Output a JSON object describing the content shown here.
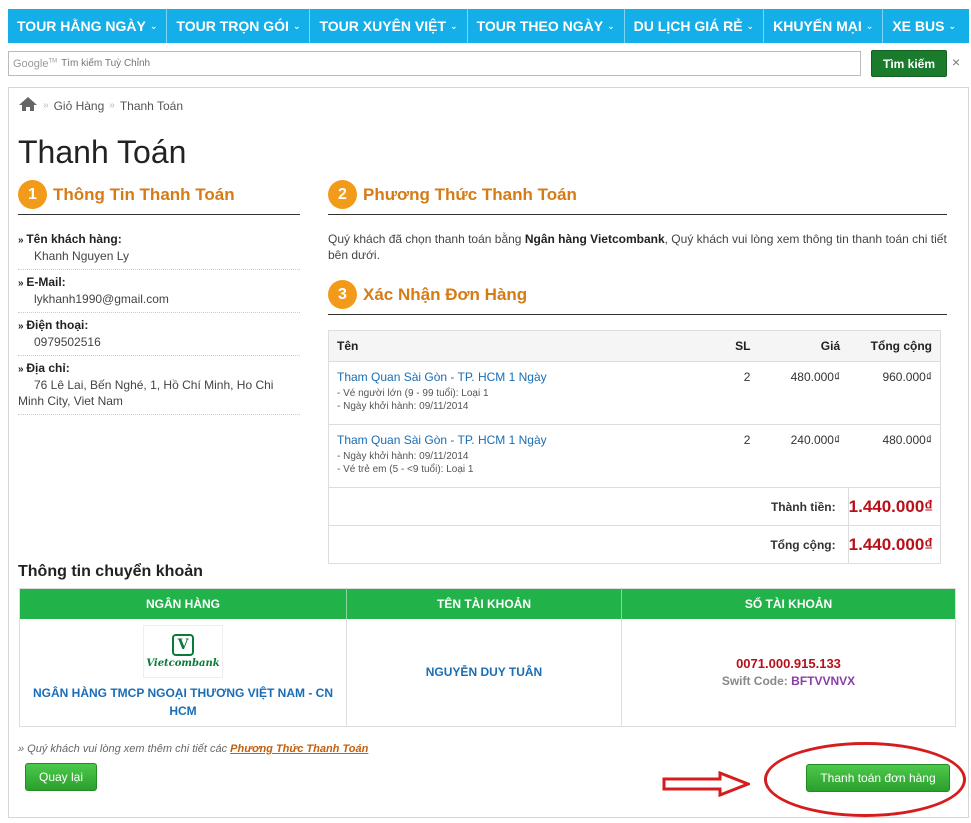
{
  "nav": {
    "items": [
      {
        "label": "TOUR HẰNG NGÀY"
      },
      {
        "label": "TOUR TRỌN GÓI"
      },
      {
        "label": "TOUR XUYÊN VIỆT"
      },
      {
        "label": "TOUR THEO NGÀY"
      },
      {
        "label": "DU LỊCH GIÁ RẺ"
      },
      {
        "label": "KHUYẾN MẠI"
      },
      {
        "label": "XE BUS"
      }
    ],
    "caret": "⌄"
  },
  "search": {
    "brand": "Google",
    "placeholder": "Tìm kiếm Tuỳ Chỉnh",
    "button_label": "Tìm kiếm",
    "close_glyph": "×"
  },
  "breadcrumb": {
    "items": [
      "Giỏ Hàng",
      "Thanh Toán"
    ],
    "sep": "»"
  },
  "page_title": "Thanh Toán",
  "sections": {
    "s1": {
      "num": "1",
      "title": "Thông Tin Thanh Toán"
    },
    "s2": {
      "num": "2",
      "title": "Phương Thức Thanh Toán"
    },
    "s3": {
      "num": "3",
      "title": "Xác Nhận Đơn Hàng"
    }
  },
  "customer": {
    "name_label": "Tên khách hàng:",
    "name": "Khanh Nguyen Ly",
    "email_label": "E-Mail:",
    "email": "lykhanh1990@gmail.com",
    "phone_label": "Điện thoại:",
    "phone": "0979502516",
    "address_label": "Địa chỉ:",
    "address": "76 Lê Lai, Bến Nghé, 1, Hồ Chí Minh, Ho Chi Minh City, Viet Nam"
  },
  "payment": {
    "desc_prefix": "Quý khách đã chọn thanh toán bằng ",
    "method": "Ngân hàng Vietcombank",
    "desc_suffix": ", Quý khách vui lòng xem thông tin thanh toán chi tiết bên dưới."
  },
  "order": {
    "headers": {
      "name": "Tên",
      "qty": "SL",
      "price": "Giá",
      "total": "Tổng cộng"
    },
    "items": [
      {
        "name": "Tham Quan Sài Gòn - TP. HCM 1 Ngày",
        "sub1": "- Vé người lớn (9 - 99 tuổi): Loại 1",
        "sub2": "- Ngày khởi hành: 09/11/2014",
        "qty": "2",
        "price": "480.000₫",
        "total": "960.000₫"
      },
      {
        "name": "Tham Quan Sài Gòn - TP. HCM 1 Ngày",
        "sub1": "- Ngày khởi hành: 09/11/2014",
        "sub2": "- Vé trẻ em (5 - <9 tuổi): Loại 1",
        "qty": "2",
        "price": "240.000₫",
        "total": "480.000₫"
      }
    ],
    "subtotal_label": "Thành tiền:",
    "subtotal": "1.440.000₫",
    "grand_label": "Tổng cộng:",
    "grand": "1.440.000₫"
  },
  "transfer": {
    "title": "Thông tin chuyển khoản",
    "headers": {
      "bank": "NGÂN HÀNG",
      "acc_name": "TÊN TÀI KHOẢN",
      "acc_no": "SỐ TÀI KHOẢN"
    },
    "logo_text": "Vietcombank",
    "bank_name": "NGÂN HÀNG TMCP NGOẠI THƯƠNG VIỆT NAM - CN HCM",
    "acc_name": "NGUYỄN DUY TUÂN",
    "acc_no": "0071.000.915.133",
    "swift_label": "Swift Code:",
    "swift": "BFTVVNVX"
  },
  "note": {
    "text": "» Quý khách vui lòng xem thêm chi tiết các ",
    "link": "Phương Thức Thanh Toán"
  },
  "buttons": {
    "back": "Quay lại",
    "pay": "Thanh toán đơn hàng"
  },
  "colors": {
    "nav_bg": "#14aee9",
    "accent_orange": "#f29b1b",
    "section_title": "#d67b15",
    "green": "#21b24a",
    "price_red": "#b8101a",
    "annotation_red": "#d51d1d"
  }
}
